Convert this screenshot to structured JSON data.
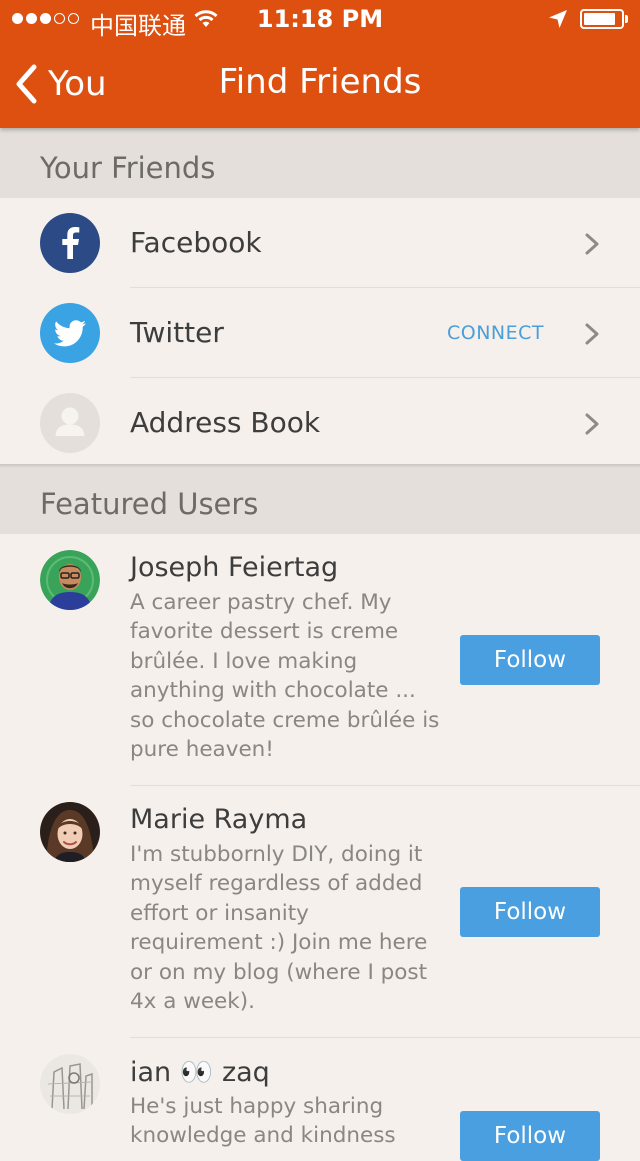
{
  "status_bar": {
    "carrier": "中国联通",
    "time": "11:18 PM",
    "signal_bars": 3,
    "signal_total": 5,
    "battery_level": 0.85
  },
  "nav": {
    "back_label": "You",
    "title": "Find Friends"
  },
  "your_friends": {
    "header": "Your Friends",
    "items": [
      {
        "label": "Facebook",
        "icon": "facebook-icon",
        "action": ""
      },
      {
        "label": "Twitter",
        "icon": "twitter-icon",
        "action": "CONNECT"
      },
      {
        "label": "Address Book",
        "icon": "address-book-icon",
        "action": ""
      }
    ]
  },
  "featured_users": {
    "header": "Featured Users",
    "users": [
      {
        "name": "Joseph Feiertag",
        "bio": "A career pastry chef. My favorite dessert is creme brûlée. I love making anything with chocolate ... so chocolate creme brûlée is pure heaven!",
        "button": "Follow"
      },
      {
        "name": "Marie Rayma",
        "bio": "I'm stubbornly DIY, doing it myself regardless of added effort or insanity requirement :) Join me here or on my blog (where I post 4x a week).",
        "button": "Follow"
      },
      {
        "name": "ian 👀 zaq",
        "bio": "He's just happy sharing knowledge and kindness",
        "button": "Follow"
      }
    ]
  },
  "colors": {
    "header_bg": "#de5010",
    "page_bg": "#f5f0eb",
    "section_bg": "#e4dfda",
    "follow_button": "#4a9fe0",
    "connect_text": "#4a9fd8",
    "facebook": "#2c4b86",
    "twitter": "#3aa3e4"
  }
}
